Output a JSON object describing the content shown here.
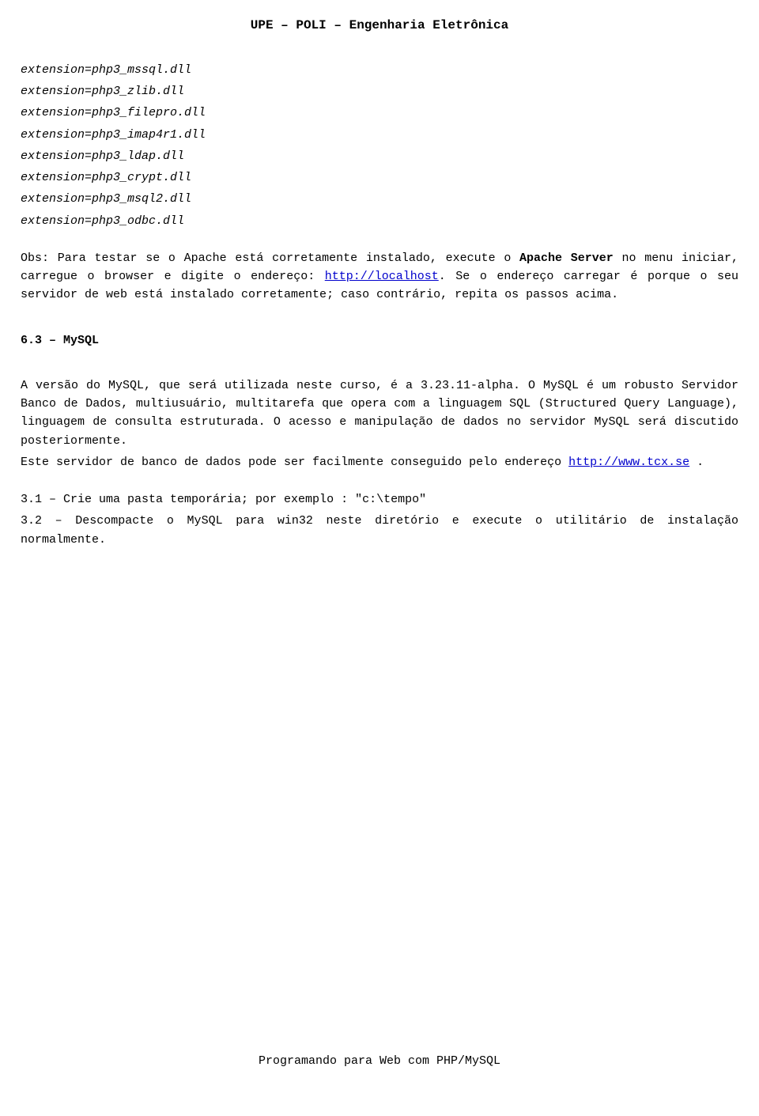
{
  "header": {
    "title": "UPE – POLI – Engenharia Eletrônica"
  },
  "extensions": [
    "extension=php3_mssql.dll",
    "extension=php3_zlib.dll",
    "extension=php3_filepro.dll",
    "extension=php3_imap4r1.dll",
    "extension=php3_ldap.dll",
    "extension=php3_crypt.dll",
    "extension=php3_msql2.dll",
    "extension=php3_odbc.dll"
  ],
  "obs": {
    "part1": "Obs: Para testar se o Apache  está corretamente instalado, execute o ",
    "bold1": "Apache Server",
    "part2": " no menu iniciar, carregue o browser e digite o endereço: ",
    "link1_text": "http://localhost",
    "part3": ". Se o endereço carregar é porque o seu servidor de web está instalado corretamente; caso contrário, repita os passos acima."
  },
  "mysql_heading": "6.3 – MySQL",
  "mysql_para": {
    "part1": "A versão do MySQL, que será utilizada neste curso, é a 3.23.11-alpha. O MySQL é um robusto Servidor  Banco de Dados, multiusuário, multitarefa que opera com a linguagem SQL (Structured  Query Language), linguagem de consulta estruturada.  O acesso e manipulação de dados no servidor MySQL será discutido posteriormente.",
    "part2a": "Este servidor de banco de dados pode ser facilmente conseguido pelo endereço ",
    "link2_text": "http://www.tcx.se",
    "part2b": " ."
  },
  "steps": {
    "s1": "3.1 – Crie uma pasta temporária; por exemplo : \"c:\\tempo\"",
    "s2": "3.2 – Descompacte o MySQL para win32 neste diretório e execute o utilitário de instalação normalmente."
  },
  "footer": "Programando para Web com PHP/MySQL"
}
